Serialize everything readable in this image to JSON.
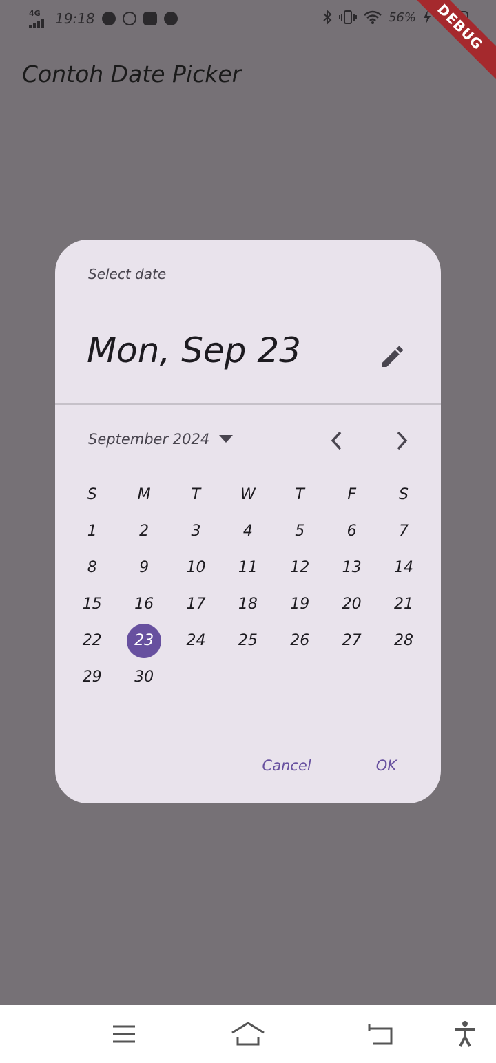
{
  "status_bar": {
    "network": "4G",
    "time": "19:18",
    "battery_percent": "56%",
    "apps": [
      "spotify-icon",
      "whatsapp-icon",
      "discord-icon",
      "telegram-icon"
    ]
  },
  "debug_banner": "DEBUG",
  "appbar": {
    "title": "Contoh Date Picker"
  },
  "dialog": {
    "label": "Select date",
    "selected_date_text": "Mon, Sep 23",
    "month_year": "September 2024",
    "weekday_headers": [
      "S",
      "M",
      "T",
      "W",
      "T",
      "F",
      "S"
    ],
    "weeks": [
      [
        "1",
        "2",
        "3",
        "4",
        "5",
        "6",
        "7"
      ],
      [
        "8",
        "9",
        "10",
        "11",
        "12",
        "13",
        "14"
      ],
      [
        "15",
        "16",
        "17",
        "18",
        "19",
        "20",
        "21"
      ],
      [
        "22",
        "23",
        "24",
        "25",
        "26",
        "27",
        "28"
      ],
      [
        "29",
        "30",
        "",
        "",
        "",
        "",
        ""
      ]
    ],
    "selected_day": "23",
    "cancel_label": "Cancel",
    "ok_label": "OK"
  },
  "colors": {
    "scrim": "#767176",
    "dialog_bg": "#e9e3ec",
    "accent": "#67509f",
    "debug_ribbon": "#a5292d"
  }
}
